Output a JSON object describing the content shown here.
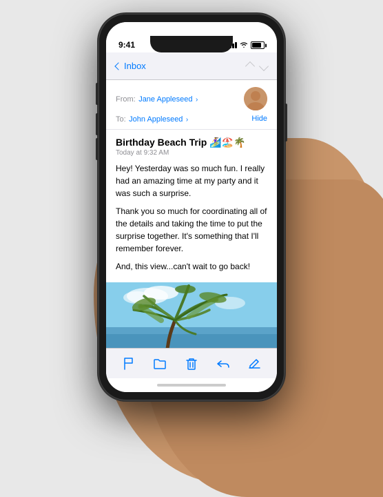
{
  "status": {
    "time": "9:41",
    "signal": [
      3,
      5,
      7,
      9,
      11
    ],
    "battery_level": 80
  },
  "nav": {
    "back_label": "Inbox",
    "up_label": "Previous",
    "down_label": "Next"
  },
  "email": {
    "from_label": "From:",
    "from_name": "Jane Appleseed",
    "to_label": "To:",
    "to_name": "John Appleseed",
    "hide_label": "Hide",
    "subject": "Birthday Beach Trip 🏄‍♀️🏖️🌴",
    "time": "Today at 9:32 AM",
    "body_paragraph1": "Hey! Yesterday was so much fun. I really had an amazing time at my party and it was such a surprise.",
    "body_paragraph2": "Thank you so much for coordinating all of the details and taking the time to put the surprise together. It's something that I'll remember forever.",
    "body_paragraph3": "And, this view...can't wait to go back!"
  },
  "toolbar": {
    "flag_icon": "🚩",
    "folder_icon": "📁",
    "trash_icon": "🗑",
    "reply_icon": "↩",
    "compose_icon": "✏"
  }
}
